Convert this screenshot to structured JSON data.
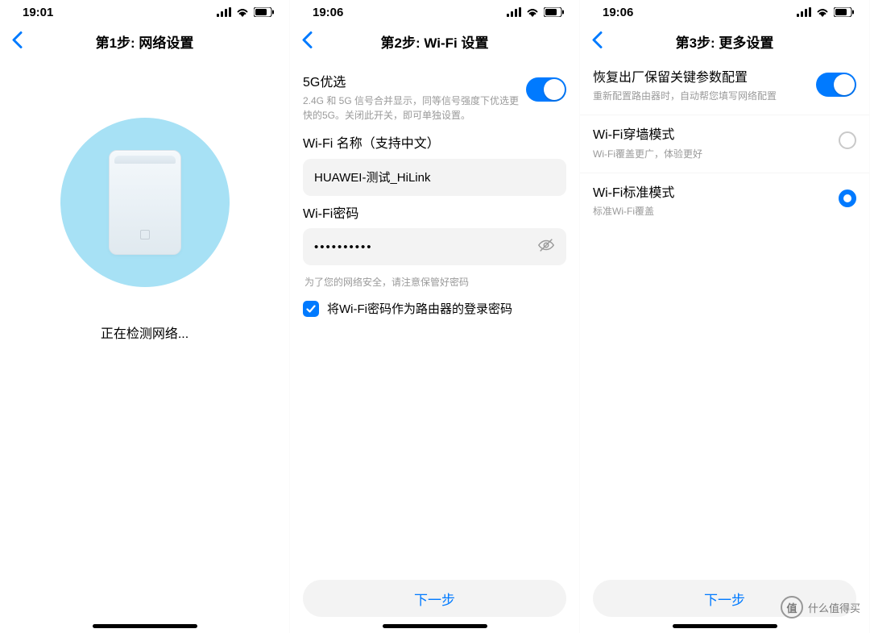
{
  "screens": [
    {
      "status_time": "19:01",
      "title": "第1步: 网络设置",
      "detecting_text": "正在检测网络..."
    },
    {
      "status_time": "19:06",
      "title": "第2步: Wi-Fi 设置",
      "opt5g_label": "5G优选",
      "opt5g_sub": "2.4G 和 5G 信号合并显示，同等信号强度下优选更快的5G。关闭此开关，即可单独设置。",
      "name_label": "Wi-Fi 名称（支持中文）",
      "name_value": "HUAWEI-测试_HiLink",
      "pwd_label": "Wi-Fi密码",
      "pwd_value": "••••••••••",
      "pwd_note": "为了您的网络安全，请注意保管好密码",
      "chk_label": "将Wi-Fi密码作为路由器的登录密码",
      "next_label": "下一步"
    },
    {
      "status_time": "19:06",
      "title": "第3步: 更多设置",
      "restore_label": "恢复出厂保留关键参数配置",
      "restore_sub": "重新配置路由器时，自动帮您填写网络配置",
      "wall_label": "Wi-Fi穿墙模式",
      "wall_sub": "Wi-Fi覆盖更广，体验更好",
      "std_label": "Wi-Fi标准模式",
      "std_sub": "标准Wi-Fi覆盖",
      "next_label": "下一步"
    }
  ],
  "watermark": "什么值得买"
}
